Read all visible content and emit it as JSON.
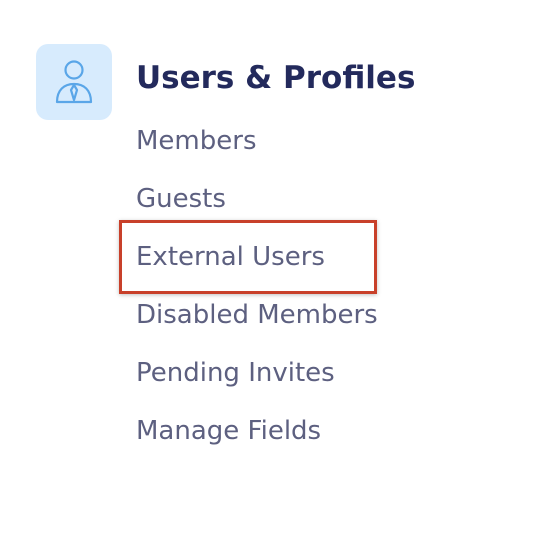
{
  "section": {
    "icon": "user-profile-icon",
    "icon_tile_color": "#d7ebfd",
    "icon_stroke_color": "#5aa6e8",
    "title": "Users & Profiles",
    "title_color": "#232a5c"
  },
  "menu": {
    "item_color": "#5d6080",
    "items": [
      {
        "label": "Members"
      },
      {
        "label": "Guests"
      },
      {
        "label": "External Users",
        "highlighted": true
      },
      {
        "label": "Disabled Members"
      },
      {
        "label": "Pending Invites"
      },
      {
        "label": "Manage Fields"
      }
    ]
  },
  "highlight_color": "#c8402a"
}
